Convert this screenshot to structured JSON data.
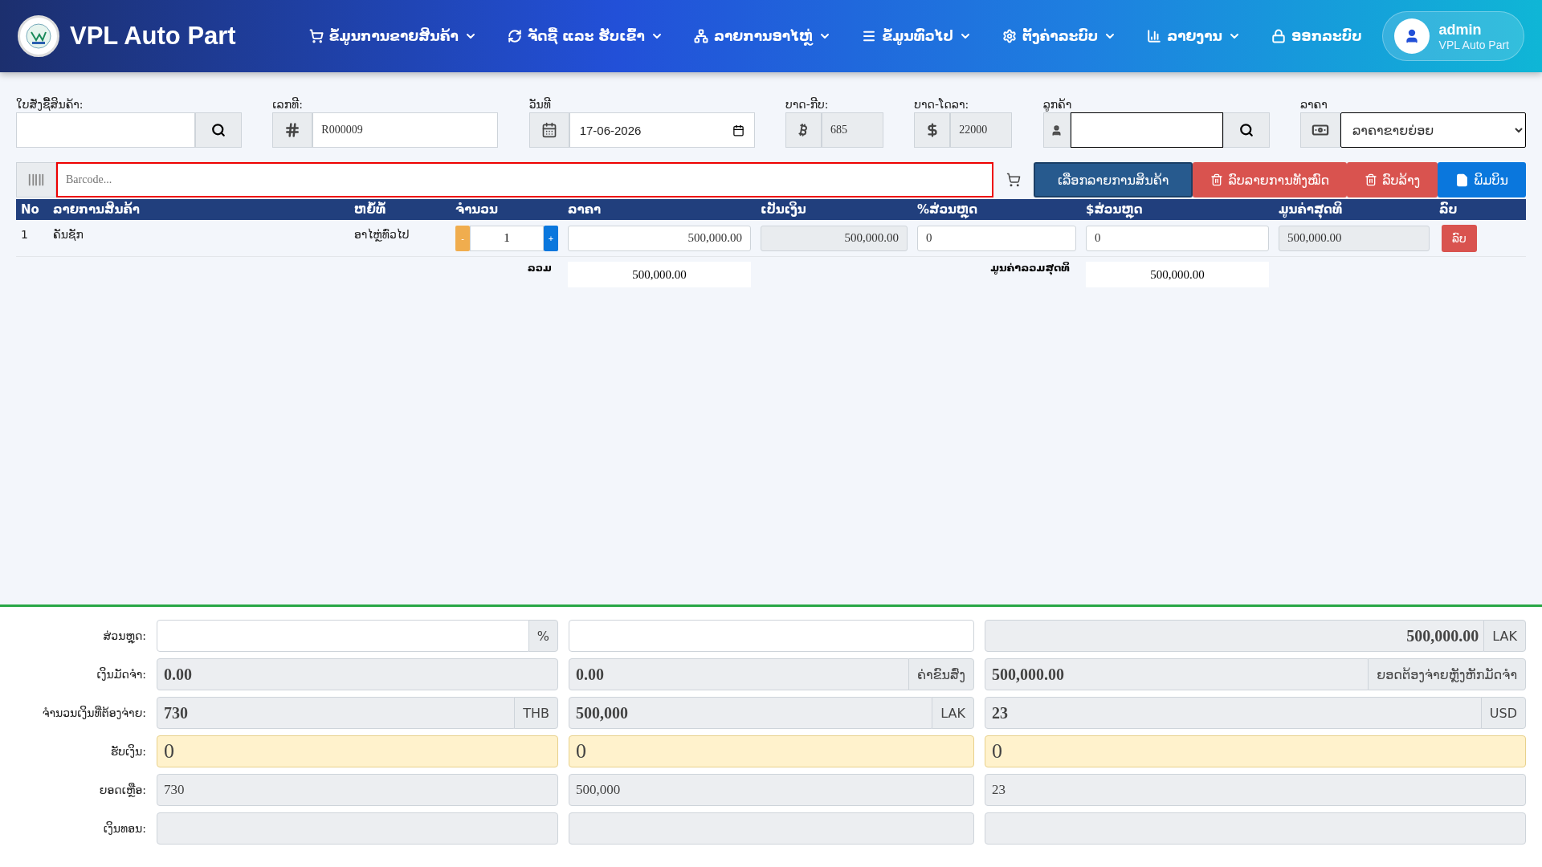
{
  "header": {
    "brand": "VPL Auto Part",
    "nav": [
      {
        "label": "ຂໍ້ມູນການຂາຍສິນຄ້າ",
        "caret": true
      },
      {
        "label": "ຈັດຊື້ ແລະ ຮັບເຂົ້າ",
        "caret": true
      },
      {
        "label": "ລາຍການອາໄຫຼ່",
        "caret": true
      },
      {
        "label": "ຂໍ້ມູນທົ່ວໄປ",
        "caret": true
      },
      {
        "label": "ຕັ້ງຄ່າລະບົບ",
        "caret": true
      },
      {
        "label": "ລາຍງານ",
        "caret": true
      },
      {
        "label": "ອອກລະບົບ",
        "caret": false
      }
    ],
    "user": {
      "name": "admin",
      "subtitle": "VPL Auto Part"
    }
  },
  "form": {
    "order": {
      "label": "ໃບສັ່ງຊື້ສິນຄ້າ:"
    },
    "number": {
      "label": "ເລກທີ:",
      "value": "R000009"
    },
    "date": {
      "label": "ວັນທີ",
      "value": "17-06-2026"
    },
    "baht_kip": {
      "label": "ບາດ-ກີບ:",
      "value": "685"
    },
    "baht_dollar": {
      "label": "ບາດ-ໂດລາ:",
      "value": "22000"
    },
    "customer": {
      "label": "ລູກຄ້າ"
    },
    "price_type": {
      "label": "ລາຄາ",
      "value": "ລາຄາຂາຍຍ່ອຍ"
    }
  },
  "barcode": {
    "placeholder": "Barcode..."
  },
  "buttons": [
    {
      "kind": "select",
      "label": "ເລືອກລາຍການສິນຄ້າ"
    },
    {
      "kind": "delete-all",
      "label": "ລົບລາຍການທັງໝົດ"
    },
    {
      "kind": "clear",
      "label": "ລົບລ້າງ"
    },
    {
      "kind": "print",
      "label": "ພິມບິນ"
    }
  ],
  "table": {
    "columns": [
      "No",
      "ລາຍການສິນຄ້າ",
      "ຫຍໍ້ທໍ້",
      "ຈຳນວນ",
      "ລາຄາ",
      "ເປັນເງິນ",
      "%ສ່ວນຫຼຸດ",
      "$ສ່ວນຫຼຸດ",
      "ມູນຄ່າສຸດທິ",
      "ລົບ"
    ],
    "rows": [
      {
        "no": "1",
        "name": "ຄັນຊັກ",
        "unit": "ອາໄຫຼ່ທົ່ວໄປ",
        "minus": "-",
        "qty": "1",
        "plus": "+",
        "price": "500,000.00",
        "amount": "500,000.00",
        "pct_discount": "0",
        "amt_discount": "0",
        "total": "500,000.00",
        "delete": "ລົບ"
      }
    ],
    "sum_label": "ລວມ",
    "sum": "500,000.00",
    "net_label": "ມູນຄ່າລວມສຸດທິ",
    "net": "500,000.00"
  },
  "payment": [
    {
      "label": "ສ່ວນຫຼຸດ:",
      "cells": [
        {
          "kind": "input",
          "addon": "%"
        },
        {
          "kind": "input"
        },
        {
          "kind": "total",
          "value": "500,000.00",
          "addon": "LAK"
        }
      ]
    },
    {
      "label": "ເງິນມັດຈຳ:",
      "cells": [
        {
          "kind": "amount",
          "value": "0.00"
        },
        {
          "kind": "amount",
          "value": "0.00",
          "addon": "ຄ່າຂົນສົ່ງ"
        },
        {
          "kind": "amount",
          "value": "500,000.00",
          "addon": "ຍອດຕ້ອງຈ່າຍຫຼັງຫັກມັດຈຳ"
        }
      ]
    },
    {
      "label": "ຈຳນວນເງິນທີ່ຕ້ອງຈ່າຍ:",
      "cells": [
        {
          "kind": "amount",
          "value": "730",
          "addon": "THB"
        },
        {
          "kind": "amount",
          "value": "500,000",
          "addon": "LAK"
        },
        {
          "kind": "amount",
          "value": "23",
          "addon": "USD"
        }
      ]
    },
    {
      "label": "ຮັບເງິນ:",
      "cells": [
        {
          "kind": "received",
          "value": "0"
        },
        {
          "kind": "received",
          "value": "0"
        },
        {
          "kind": "received",
          "value": "0"
        }
      ]
    },
    {
      "label": "ຍອດເຫຼືອ:",
      "cells": [
        {
          "kind": "plain",
          "value": "730"
        },
        {
          "kind": "plain",
          "value": "500,000"
        },
        {
          "kind": "plain",
          "value": "23"
        }
      ]
    },
    {
      "label": "ເງິນທອນ:",
      "cells": [
        {
          "kind": "plain"
        },
        {
          "kind": "plain"
        },
        {
          "kind": "plain"
        }
      ]
    }
  ]
}
